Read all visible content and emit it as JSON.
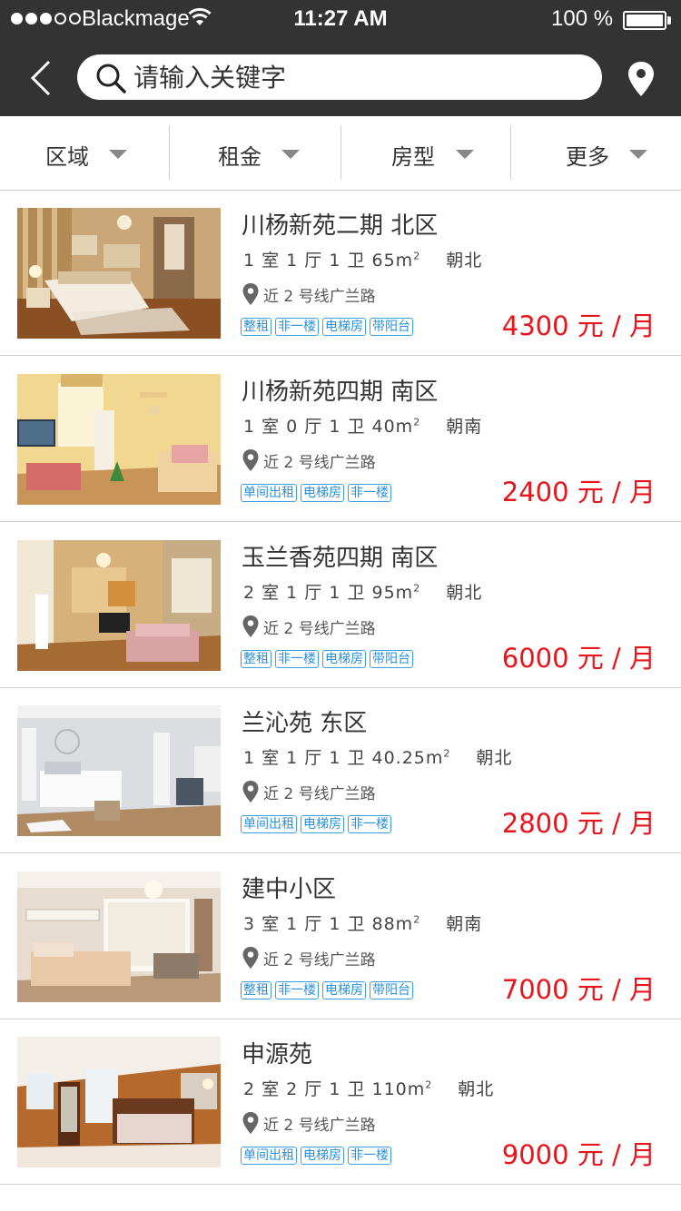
{
  "status_bar": {
    "carrier": "Blackmage",
    "time": "11:27 AM",
    "battery": "100 %"
  },
  "nav": {
    "search_placeholder": "请输入关键字",
    "icons": [
      "back-arrow-icon",
      "search-icon",
      "location-pin-icon"
    ]
  },
  "filters": [
    {
      "label": "区域"
    },
    {
      "label": "租金"
    },
    {
      "label": "房型"
    },
    {
      "label": "更多"
    }
  ],
  "listings": [
    {
      "title": "川杨新苑二期 北区",
      "layout": "1 室 1 厅 1 卫 65m",
      "area_unit_sup": "2",
      "orientation": "朝北",
      "location": "近 2 号线广兰路",
      "tags": [
        "整租",
        "非一楼",
        "电梯房",
        "带阳台"
      ],
      "price": "4300 元 / 月"
    },
    {
      "title": "川杨新苑四期 南区",
      "layout": "1 室 0 厅 1 卫 40m",
      "area_unit_sup": "2",
      "orientation": "朝南",
      "location": "近 2 号线广兰路",
      "tags": [
        "单间出租",
        "电梯房",
        "非一楼"
      ],
      "price": "2400 元 / 月"
    },
    {
      "title": "玉兰香苑四期 南区",
      "layout": "2 室 1 厅 1 卫 95m",
      "area_unit_sup": "2",
      "orientation": "朝北",
      "location": "近 2 号线广兰路",
      "tags": [
        "整租",
        "非一楼",
        "电梯房",
        "带阳台"
      ],
      "price": "6000 元 / 月"
    },
    {
      "title": "兰沁苑 东区",
      "layout": "1 室 1 厅 1 卫 40.25m",
      "area_unit_sup": "2",
      "orientation": "朝北",
      "location": "近 2 号线广兰路",
      "tags": [
        "单间出租",
        "电梯房",
        "非一楼"
      ],
      "price": "2800 元 / 月"
    },
    {
      "title": "建中小区",
      "layout": "3 室 1 厅 1 卫 88m",
      "area_unit_sup": "2",
      "orientation": "朝南",
      "location": "近 2 号线广兰路",
      "tags": [
        "整租",
        "非一楼",
        "电梯房",
        "带阳台"
      ],
      "price": "7000 元 / 月"
    },
    {
      "title": "申源苑",
      "layout": "2 室 2 厅 1 卫 110m",
      "area_unit_sup": "2",
      "orientation": "朝北",
      "location": "近 2 号线广兰路",
      "tags": [
        "单间出租",
        "电梯房",
        "非一楼"
      ],
      "price": "9000 元 / 月"
    }
  ],
  "colors": {
    "header_bg": "#333333",
    "price_red": "#e8141c",
    "tag_blue": "#2a90d8"
  }
}
